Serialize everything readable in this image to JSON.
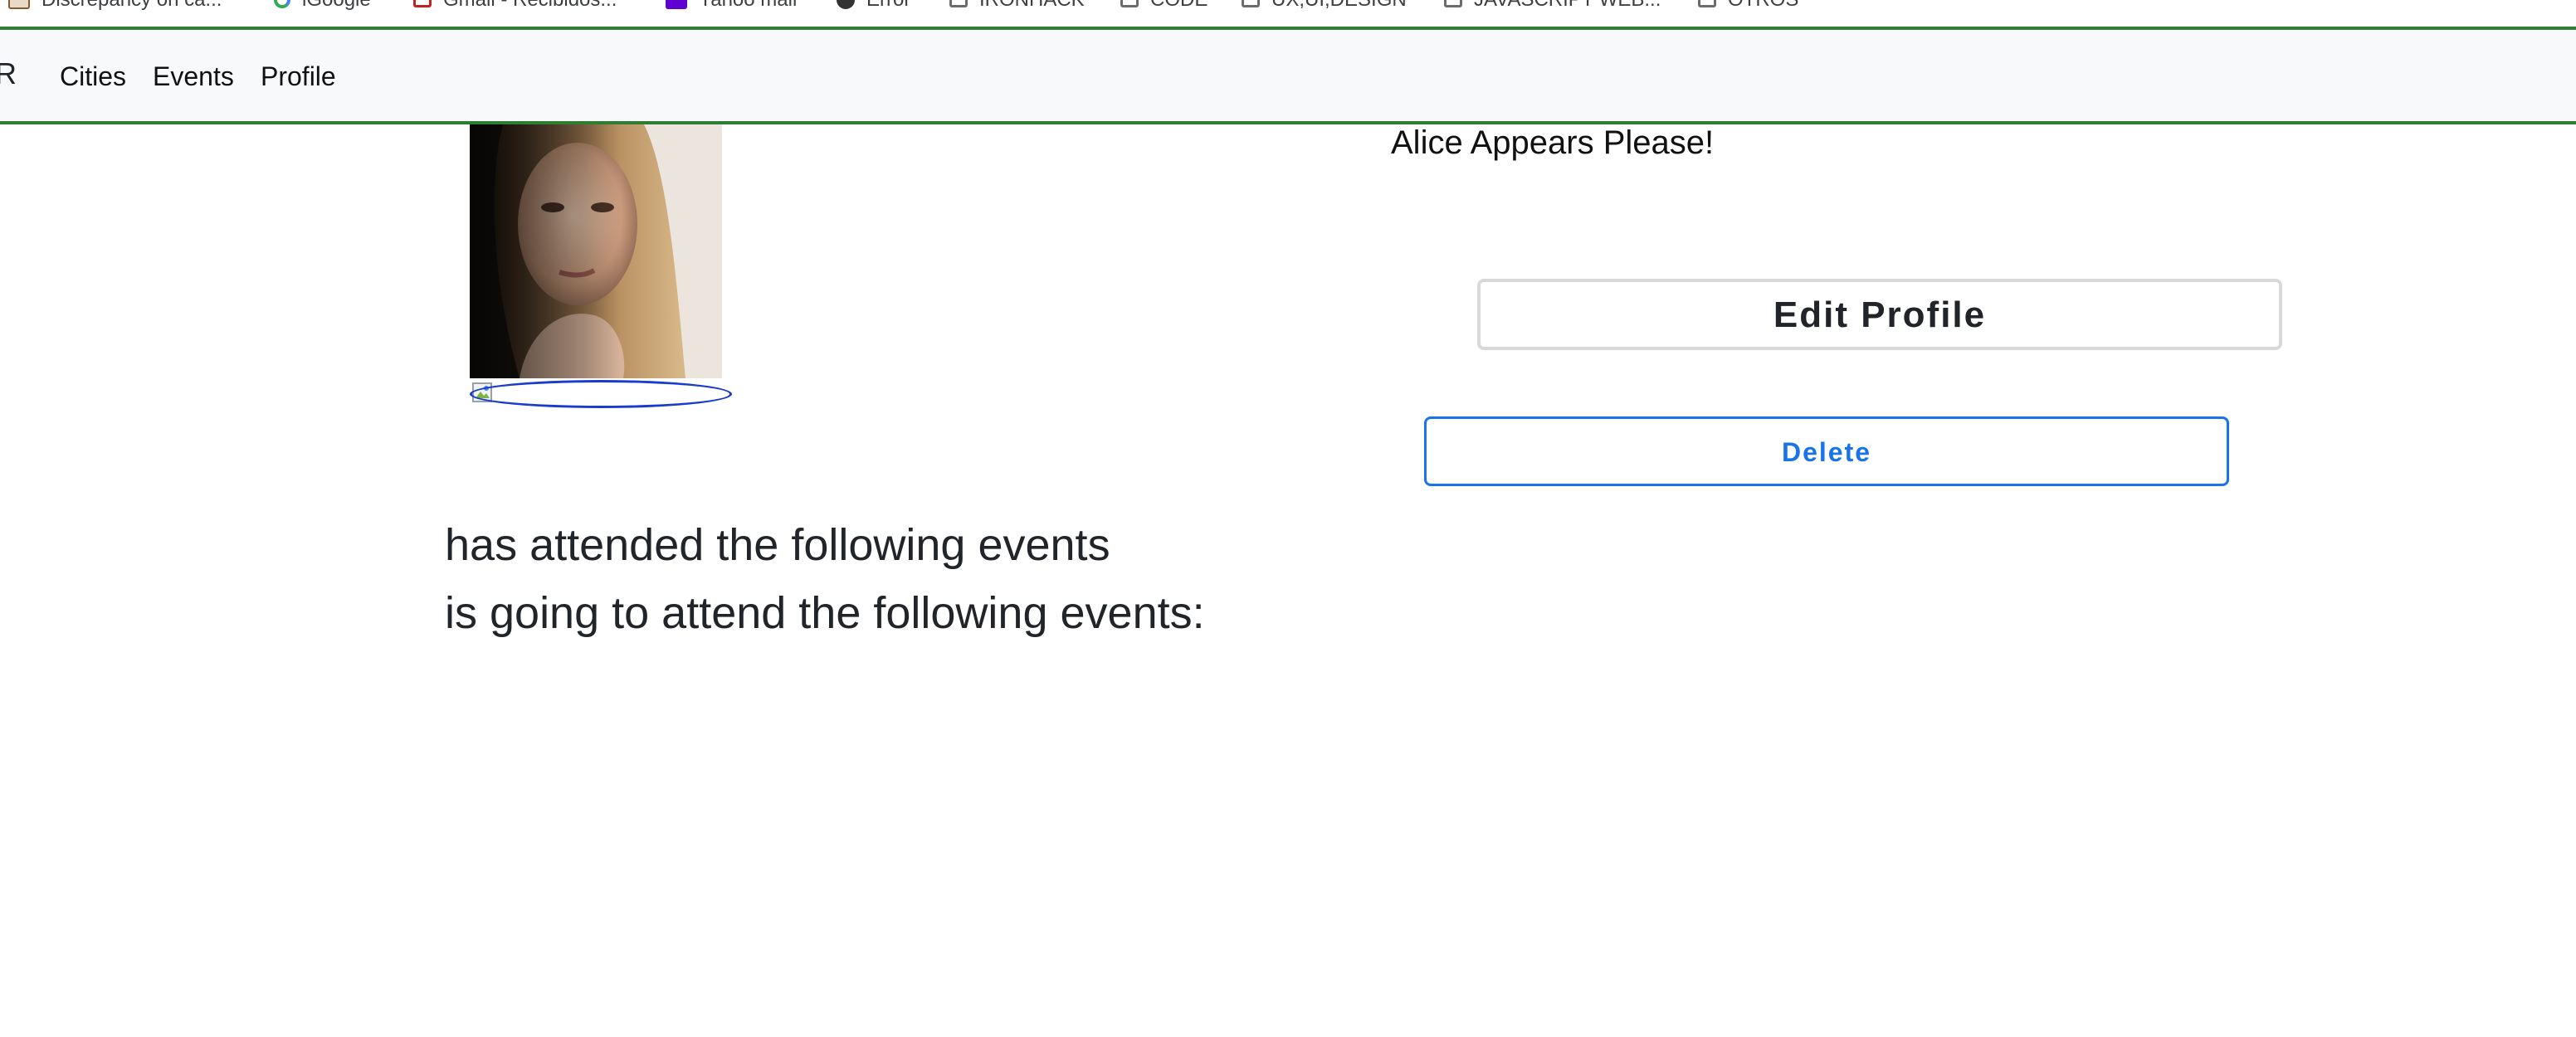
{
  "bookmarks": [
    {
      "label": "Discrepancy on ca...",
      "icon": "discrepancy-icon"
    },
    {
      "label": "iGoogle",
      "icon": "google-icon"
    },
    {
      "label": "Gmail - Recibidos...",
      "icon": "gmail-icon"
    },
    {
      "label": "Yahoo mail",
      "icon": "yahoo-icon"
    },
    {
      "label": "Error",
      "icon": "error-icon"
    },
    {
      "label": "IRONHACK",
      "icon": "folder-icon"
    },
    {
      "label": "CODE",
      "icon": "folder-icon"
    },
    {
      "label": "UX,UI,DESIGN",
      "icon": "folder-icon"
    },
    {
      "label": "JAVASCRIPT WEB...",
      "icon": "folder-icon"
    },
    {
      "label": "OTROS",
      "icon": "folder-icon"
    }
  ],
  "navbar": {
    "brand": "R",
    "links": {
      "cities": "Cities",
      "events": "Events",
      "profile": "Profile"
    }
  },
  "profile": {
    "welcome": "Alice Appears Please!",
    "edit_label": "Edit Profile",
    "delete_label": "Delete",
    "attended_heading": "has attended the following events",
    "upcoming_heading": "is going to attend the following events:"
  },
  "colors": {
    "accent_border": "#2e7d32",
    "delete_blue": "#1a73e8",
    "focus_ring": "#1a3ccc"
  }
}
